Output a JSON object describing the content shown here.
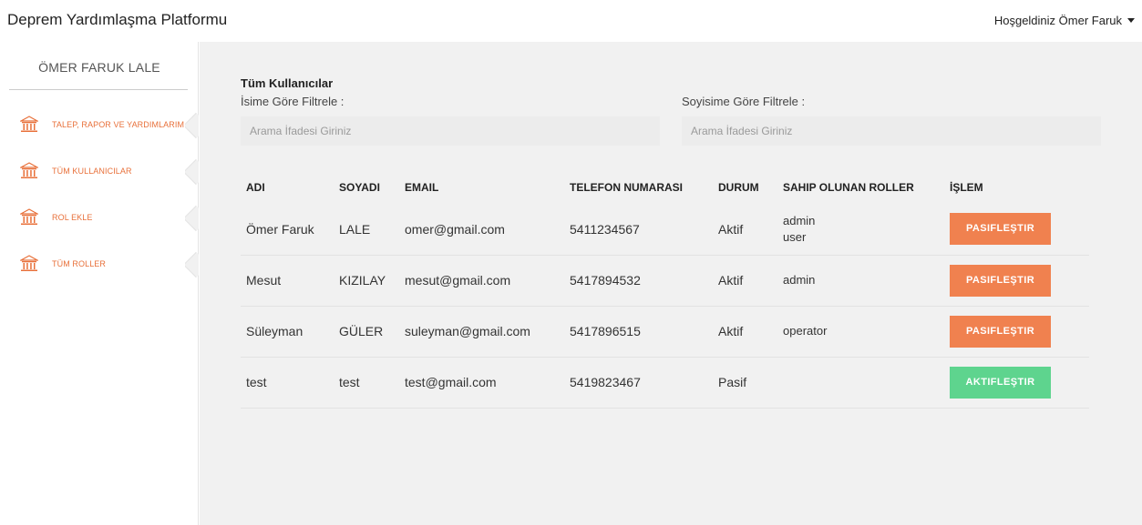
{
  "app": {
    "title": "Deprem Yardımlaşma Platformu",
    "welcome": "Hoşgeldiniz Ömer Faruk"
  },
  "sidebar": {
    "profile_name": "ÖMER FARUK LALE",
    "items": [
      {
        "label": "TALEP, RAPOR VE YARDIMLARIM",
        "icon": "bank-icon"
      },
      {
        "label": "TÜM KULLANICILAR",
        "icon": "bank-icon"
      },
      {
        "label": "ROL EKLE",
        "icon": "bank-icon"
      },
      {
        "label": "TÜM ROLLER",
        "icon": "bank-icon"
      }
    ]
  },
  "main": {
    "title": "Tüm Kullanıcılar",
    "filter_name_label": "İsime Göre Filtrele :",
    "filter_surname_label": "Soyisime Göre Filtrele :",
    "filter_name_placeholder": "Arama İfadesi Giriniz",
    "filter_surname_placeholder": "Arama İfadesi Giriniz"
  },
  "table": {
    "headers": [
      "ADI",
      "SOYADI",
      "EMAIL",
      "TELEFON NUMARASI",
      "DURUM",
      "SAHIP OLUNAN ROLLER",
      "İŞLEM"
    ],
    "rows": [
      {
        "name": "Ömer Faruk",
        "surname": "LALE",
        "email": "omer@gmail.com",
        "phone": "5411234567",
        "status": "Aktif",
        "roles": [
          "admin",
          "user"
        ],
        "action": "PASIFLEŞTIR",
        "action_type": "deactivate"
      },
      {
        "name": "Mesut",
        "surname": "KIZILAY",
        "email": "mesut@gmail.com",
        "phone": "5417894532",
        "status": "Aktif",
        "roles": [
          "admin"
        ],
        "action": "PASIFLEŞTIR",
        "action_type": "deactivate"
      },
      {
        "name": "Süleyman",
        "surname": "GÜLER",
        "email": "suleyman@gmail.com",
        "phone": "5417896515",
        "status": "Aktif",
        "roles": [
          "operator"
        ],
        "action": "PASIFLEŞTIR",
        "action_type": "deactivate"
      },
      {
        "name": "test",
        "surname": "test",
        "email": "test@gmail.com",
        "phone": "5419823467",
        "status": "Pasif",
        "roles": [],
        "action": "AKTIFLEŞTIR",
        "action_type": "activate"
      }
    ]
  },
  "colors": {
    "accent": "#e8703a",
    "deactivate_button": "#f0814f",
    "activate_button": "#5ed48e",
    "main_background": "#f1f1f1"
  }
}
